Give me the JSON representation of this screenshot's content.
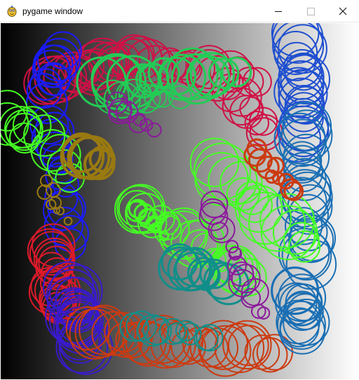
{
  "window": {
    "title": "pygame window",
    "controls": {
      "minimize": "minimize-icon",
      "maximize": "maximize-icon",
      "close": "close-icon"
    }
  },
  "canvas": {
    "background_gradient": [
      "#000000",
      "#ffffff"
    ],
    "palette": {
      "blue": "#1a1aff",
      "red": "#dd1a2a",
      "crimson": "#d01045",
      "green": "#22cc55",
      "lime": "#44ff22",
      "teal": "#108f8a",
      "steel": "#1a6fb4",
      "royal": "#1f4fd0",
      "purple": "#8a1a9a",
      "orange": "#cc3a10",
      "olive": "#9a7a10",
      "violet": "#3a1acc"
    }
  }
}
